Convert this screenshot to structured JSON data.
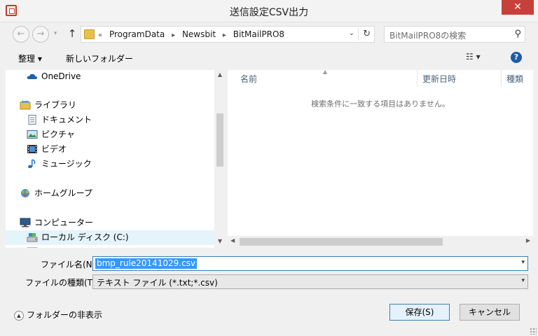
{
  "window": {
    "title": "送信設定CSV出力",
    "close_glyph": "✕"
  },
  "navigation": {
    "back_glyph": "←",
    "forward_glyph": "→",
    "up_glyph": "↑",
    "breadcrumb": {
      "overflow": "«",
      "items": [
        "ProgramData",
        "Newsbit",
        "BitMailPRO8"
      ],
      "separator": "▸"
    },
    "dropdown_glyph": "⌄",
    "refresh_glyph": "↻"
  },
  "search": {
    "placeholder": "BitMailPRO8の検索",
    "icon_glyph": "⚲"
  },
  "toolbar": {
    "organize_label": "整理 ▾",
    "new_folder_label": "新しいフォルダー",
    "view_label": "☷ ▾",
    "help_glyph": "?"
  },
  "nav_pane": {
    "items": [
      {
        "label": "OneDrive",
        "icon": "cloud-icon",
        "indent": 0
      },
      {
        "label": "ライブラリ",
        "icon": "library-icon",
        "indent": 0
      },
      {
        "label": "ドキュメント",
        "icon": "document-icon",
        "indent": 1
      },
      {
        "label": "ピクチャ",
        "icon": "picture-icon",
        "indent": 1
      },
      {
        "label": "ビデオ",
        "icon": "video-icon",
        "indent": 1
      },
      {
        "label": "ミュージック",
        "icon": "music-icon",
        "indent": 1
      },
      {
        "label": "ホームグループ",
        "icon": "homegroup-icon",
        "indent": 0
      },
      {
        "label": "コンピューター",
        "icon": "computer-icon",
        "indent": 0
      },
      {
        "label": "ローカル ディスク (C:)",
        "icon": "drive-icon",
        "indent": 1,
        "selected": true
      }
    ]
  },
  "file_list": {
    "columns": [
      "名前",
      "更新日時",
      "種類"
    ],
    "empty_message": "検索条件に一致する項目はありません。"
  },
  "form": {
    "filename_label": "ファイル名(N):",
    "filename_value": "bmp_rule20141029.csv",
    "filetype_label": "ファイルの種類(T):",
    "filetype_value": "テキスト ファイル (*.txt;*.csv)"
  },
  "footer": {
    "hide_folders_label": "フォルダーの非表示",
    "save_label": "保存(S)",
    "cancel_label": "キャンセル"
  },
  "colors": {
    "selection_blue": "#3399ff",
    "close_red": "#c7413a",
    "help_blue": "#1e5aa6"
  }
}
